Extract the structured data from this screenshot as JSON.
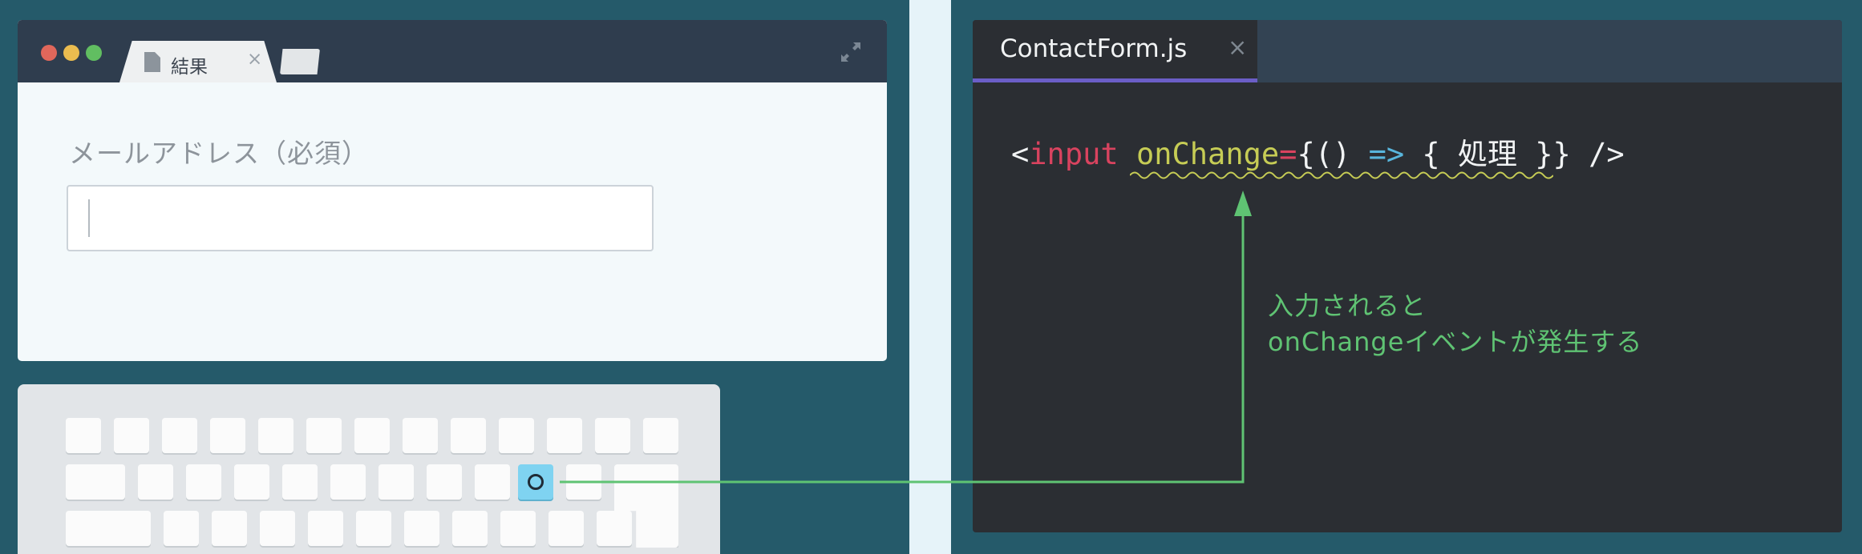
{
  "browser": {
    "tab_label": "結果",
    "tab_close": "×",
    "form": {
      "email_label": "メールアドレス（必須）",
      "email_value": ""
    }
  },
  "keyboard": {
    "active_key_label": "o"
  },
  "editor": {
    "file_tab": "ContactForm.js",
    "tab_close": "×",
    "code": {
      "open_bracket": "<",
      "tag": "input",
      "attr": "onChange",
      "equals": "=",
      "brace_paren": "{()",
      "arrow": "=>",
      "body": "{ 処理 }}",
      "close": "/>"
    },
    "annotation": {
      "line1": "入力されると",
      "line2": "onChangeイベントが発生する"
    }
  },
  "colors": {
    "background": "#255a6a",
    "annotation_green": "#5fc373",
    "tag_red": "#d9435f",
    "attr_yellow": "#c6cc55",
    "arrow_blue": "#58b6dd",
    "tab_underline": "#6b5ec7",
    "active_key": "#7fd3f1"
  }
}
